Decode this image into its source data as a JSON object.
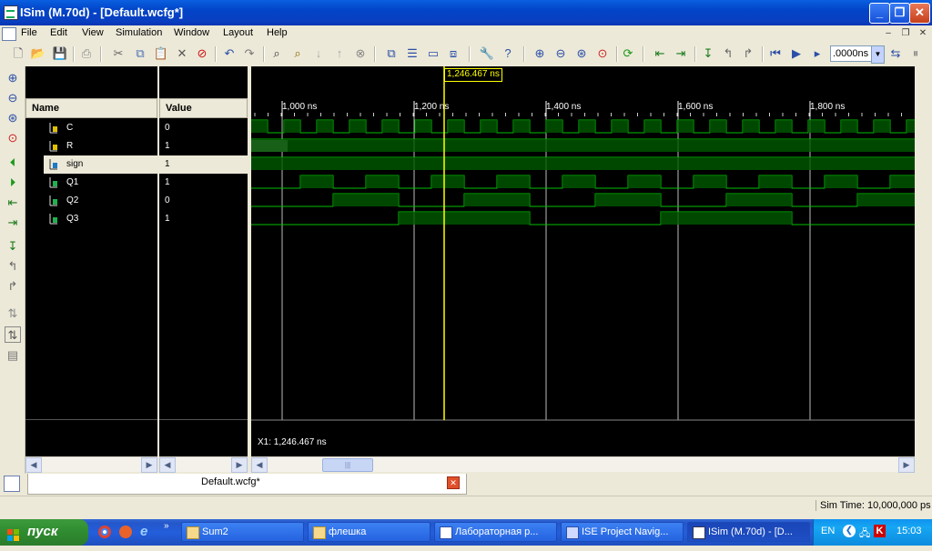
{
  "window": {
    "title": "ISim (M.70d) - [Default.wcfg*]"
  },
  "menu": {
    "items": [
      "File",
      "Edit",
      "View",
      "Simulation",
      "Window",
      "Layout",
      "Help"
    ]
  },
  "toolbar": {
    "time_value": ".0000ns"
  },
  "names_header": "Name",
  "values_header": "Value",
  "signals": [
    {
      "name": "C",
      "value": "0"
    },
    {
      "name": "R",
      "value": "1"
    },
    {
      "name": "sign",
      "value": "1"
    },
    {
      "name": "Q1",
      "value": "1"
    },
    {
      "name": "Q2",
      "value": "0"
    },
    {
      "name": "Q3",
      "value": "1"
    }
  ],
  "wave": {
    "cursor_label": "1,246.467 ns",
    "x1_readout": "X1: 1,246.467 ns",
    "ticks": [
      "1,000 ns",
      "1,200 ns",
      "1,400 ns",
      "1,600 ns",
      "1,800 ns"
    ]
  },
  "tab": {
    "label": "Default.wcfg*"
  },
  "status": {
    "sim_time": "Sim Time: 10,000,000 ps"
  },
  "taskbar": {
    "start_label": "пуск",
    "tasks": [
      "Sum2",
      "флешка",
      "Лабораторная р...",
      "ISE Project Navig...",
      "ISim (M.70d) - [D..."
    ],
    "tray_lang": "EN",
    "clock": "15:03"
  },
  "colors": {
    "wave": "#00c000",
    "cursor": "#ffff00",
    "titlebar": "#0a54d4",
    "wave_bg": "#000000"
  }
}
